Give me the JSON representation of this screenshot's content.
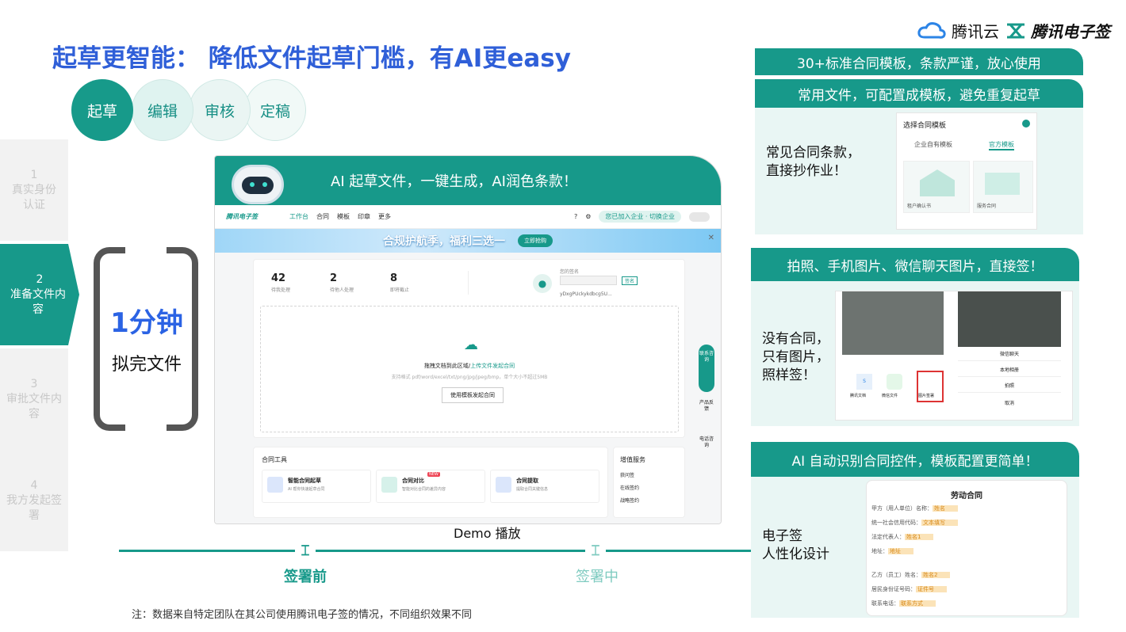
{
  "header": {
    "title": "起草更智能：  降低文件起草门槛，有AI更easy",
    "brand_cloud": "腾讯云",
    "brand_esign": "腾讯电子签"
  },
  "flow_steps": [
    "起草",
    "编辑",
    "审核",
    "定稿"
  ],
  "side_steps": [
    {
      "num": "1",
      "label": "真实身份认证"
    },
    {
      "num": "2",
      "label": "准备文件内容"
    },
    {
      "num": "3",
      "label": "审批文件内容"
    },
    {
      "num": "4",
      "label": "我方发起签署"
    }
  ],
  "highlight": {
    "value": "1分钟",
    "caption": "拟完文件"
  },
  "demo": {
    "headline": "AI 起草文件，一键生成，AI润色条款！",
    "caption": "Demo 播放",
    "nav": {
      "logo": "腾讯电子签",
      "items": [
        "工作台",
        "合同",
        "模板",
        "印章",
        "更多"
      ],
      "notice": "您已加入企业 · 切换企业"
    },
    "banner": "合规护航季，福利三选一",
    "banner_btn": "立即抢购",
    "stats": [
      {
        "value": "42",
        "label": "待我处理"
      },
      {
        "value": "2",
        "label": "待他人处理"
      },
      {
        "value": "8",
        "label": "即将截止"
      }
    ],
    "account_label": "您的签名",
    "account_id": "yDxgPUckykdbcg5U...",
    "upload_text": "拖拽文档到此区域/",
    "upload_link": "上传文件发起合同",
    "upload_hint": "支持格式 pdf/word/excel/txt/png/jpg/jpeg/bmp，单个大小不超过5MB",
    "template_btn": "使用模板发起合同",
    "tools_title": "合同工具",
    "tools": [
      {
        "name": "智能合同起草",
        "desc": "AI 帮你快速起草合同"
      },
      {
        "name": "合同对比",
        "desc": "智能对比合同的差异内容",
        "badge": "NEW"
      },
      {
        "name": "合同提取",
        "desc": "提取合同关键信息"
      }
    ],
    "services_title": "增值服务",
    "services": [
      "获问签",
      "在线签约",
      "战略签约"
    ],
    "side_tools": [
      "联系咨询",
      "产品反馈",
      "电话咨询"
    ]
  },
  "right": {
    "bar1": "30+标准合同模板，条款严谨，放心使用",
    "bar2": "常用文件，可配置成模板，避免重复起草",
    "text2": "常见合同条款，\n直接抄作业！",
    "tpl_title": "选择合同模板",
    "tpl_tabs": [
      "企业自有模板",
      "官方模板"
    ],
    "tpl_cards": [
      "租户确认书",
      "服务合同"
    ],
    "bar3": "拍照、手机图片、微信聊天图片，直接签！",
    "text3": "没有合同，\n只有图片，\n照样签！",
    "phone_items": [
      "腾讯文档",
      "微信文件",
      "图片签署"
    ],
    "phone_menu": [
      "微信聊天",
      "本地相册",
      "拍照",
      "取消"
    ],
    "bar4": "AI 自动识别合同控件，模板配置更简单！",
    "text4": "电子签\n人性化设计",
    "doc_title": "劳动合同",
    "doc_lines": [
      {
        "label": "甲方（用人单位）名称：",
        "field": "姓名"
      },
      {
        "label": "统一社会信用代码：",
        "field": "文本填写"
      },
      {
        "label": "法定代表人：",
        "field": "姓名1"
      },
      {
        "label": "地址：",
        "field": "地址"
      },
      {
        "label": "乙方（员工）姓名：",
        "field": "姓名2"
      },
      {
        "label": "居民身份证号码：",
        "field": "证件号"
      },
      {
        "label": "联系电话：",
        "field": "联系方式"
      }
    ]
  },
  "timeline": [
    "签署前",
    "签署中"
  ],
  "note": "注：数据来自特定团队在其公司使用腾讯电子签的情况，不同组织效果不同",
  "colors": {
    "primary": "#17998a",
    "title_blue": "#2f5fd8",
    "highlight_blue": "#2b63e4"
  }
}
